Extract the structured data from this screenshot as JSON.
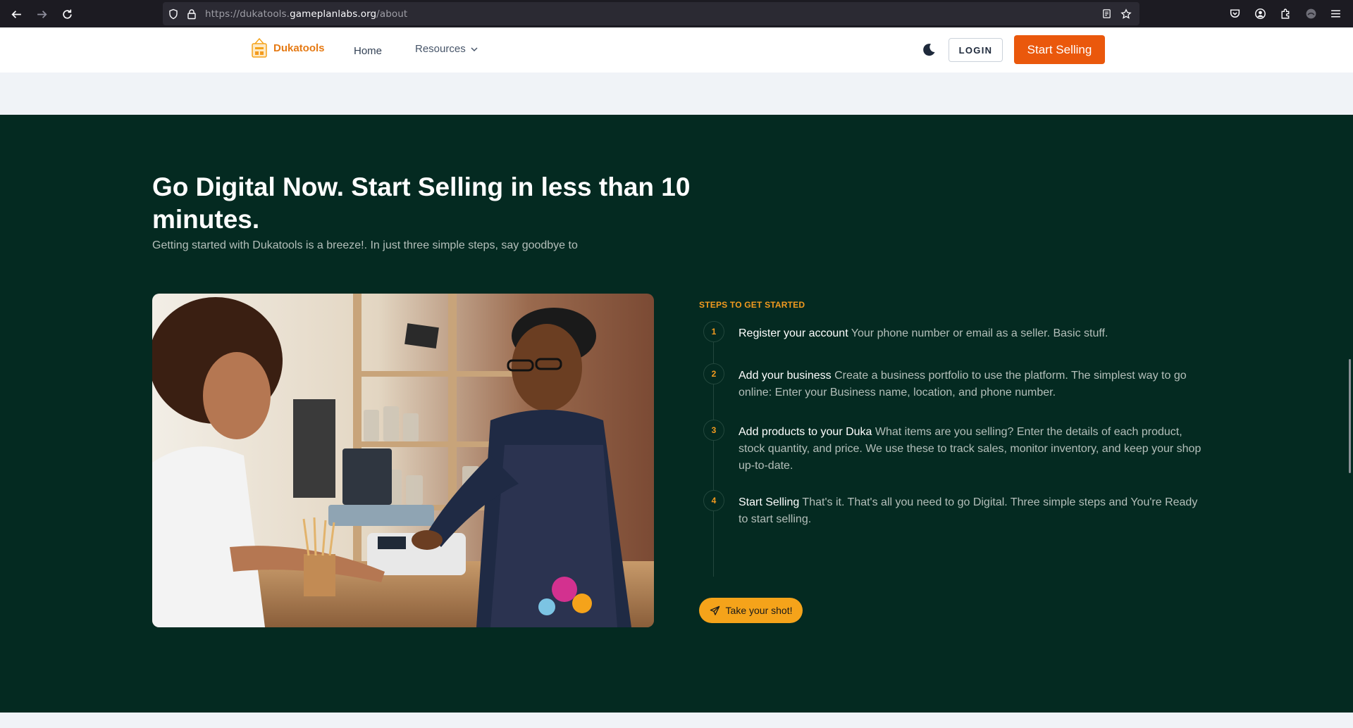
{
  "browser": {
    "url_prefix": "https://dukatools.",
    "url_domain": "gameplanlabs.org",
    "url_path": "/about"
  },
  "header": {
    "logo_text": "Dukatools",
    "nav_home": "Home",
    "nav_resources": "Resources",
    "login_label": "LOGIN",
    "start_selling_label": "Start Selling"
  },
  "hero": {
    "title": "Go Digital Now. Start Selling in less than 10 minutes.",
    "subtitle": "Getting started with Dukatools is a breeze!. In just three simple steps, say goodbye to",
    "steps_label": "STEPS TO GET STARTED",
    "steps": [
      {
        "num": "1",
        "title": "Register your account",
        "text": "Your phone number or email as a seller. Basic stuff."
      },
      {
        "num": "2",
        "title": "Add your business",
        "text": "Create a business portfolio to use the platform. The simplest way to go online: Enter your Business name, location, and phone number."
      },
      {
        "num": "3",
        "title": "Add products to your Duka",
        "text": "What items are you selling? Enter the details of each product, stock quantity, and price. We use these to track sales, monitor inventory, and keep your shop up-to-date."
      },
      {
        "num": "4",
        "title": "Start Selling",
        "text": "That's it. That's all you need to go Digital. Three simple steps and You're Ready to start selling."
      }
    ],
    "cta_label": "Take your shot!"
  },
  "colors": {
    "hero_bg": "#042a21",
    "accent_orange": "#ea580c",
    "accent_amber": "#f5a31a"
  }
}
